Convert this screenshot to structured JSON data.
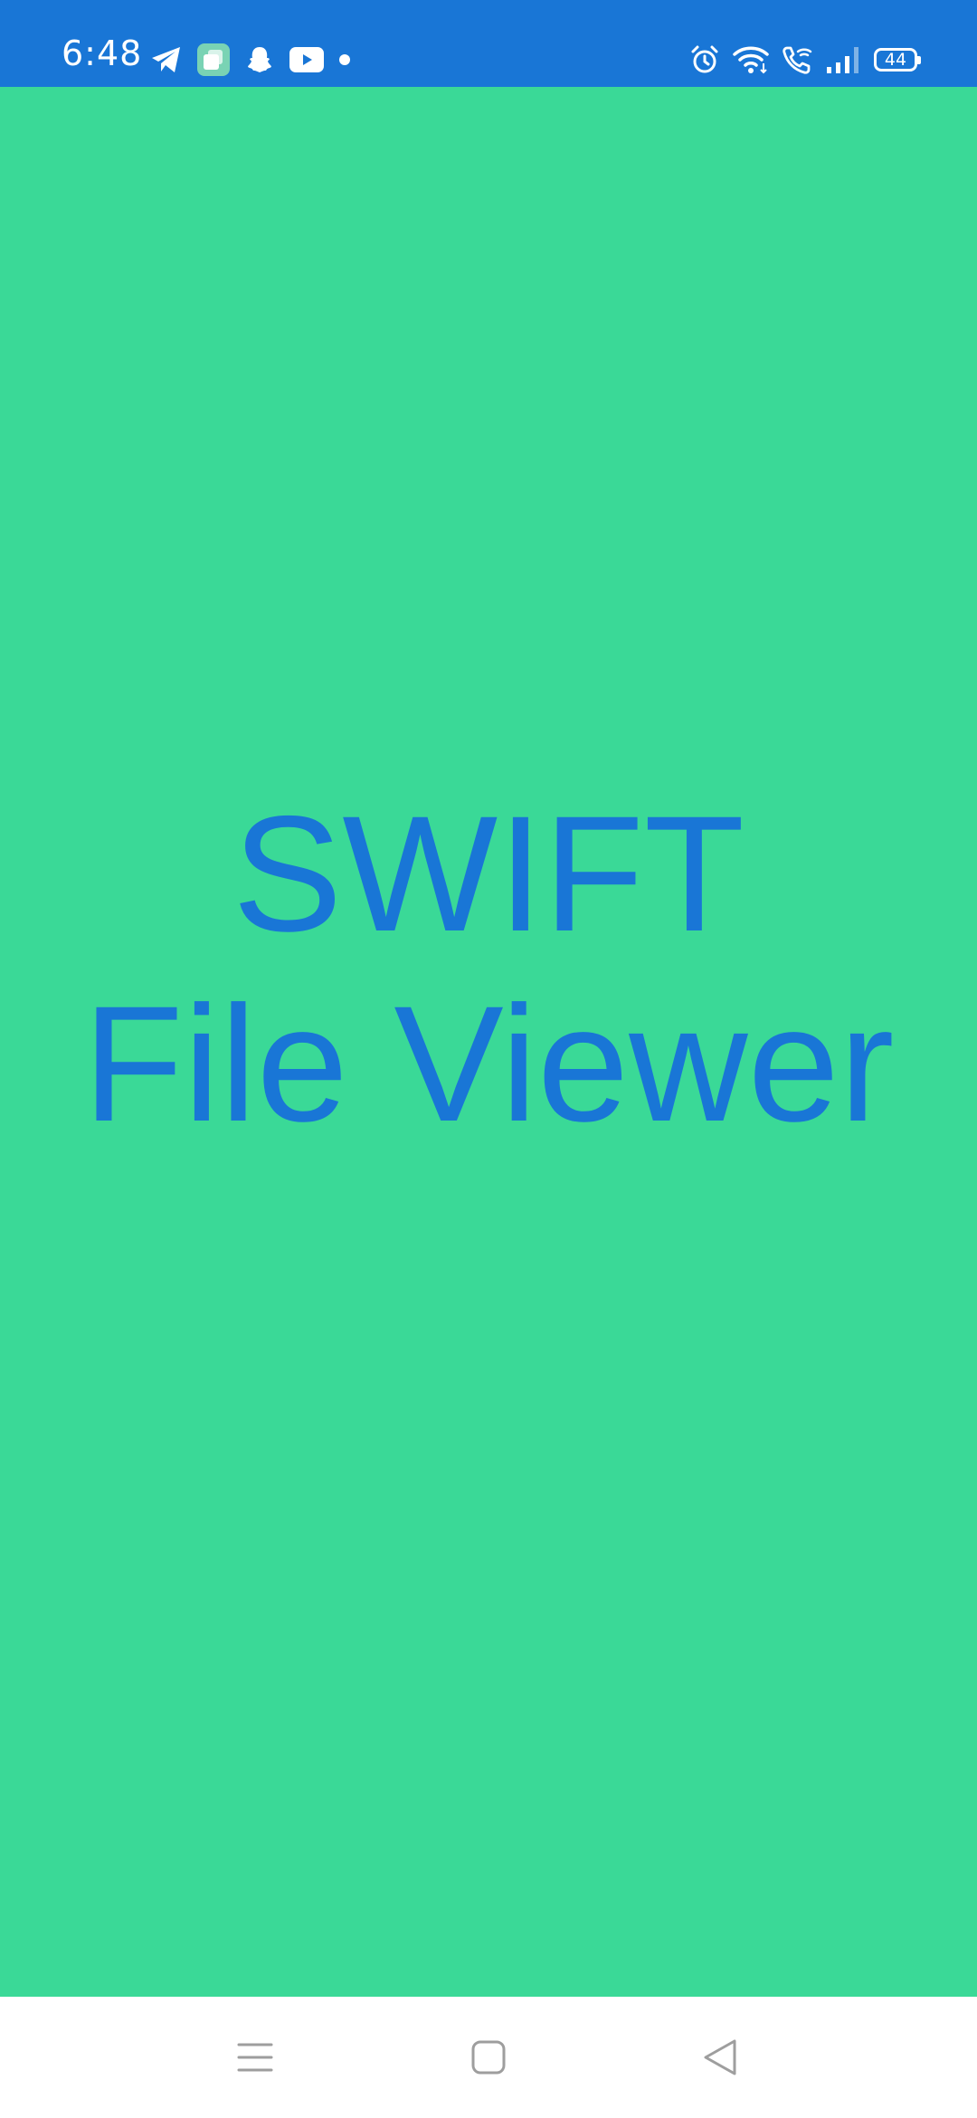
{
  "status_bar": {
    "time": "6:48",
    "battery_level": "44",
    "background_color": "#1976d6",
    "left_icons": [
      "telegram-icon",
      "app-layers-icon",
      "snapchat-icon",
      "youtube-icon",
      "notification-dot-icon"
    ],
    "right_icons": [
      "alarm-icon",
      "wifi-icon",
      "wifi-call-icon",
      "signal-icon",
      "battery-icon"
    ]
  },
  "splash": {
    "title_line1": "SWIFT",
    "title_line2": "File Viewer",
    "background_color": "#3ad997",
    "text_color": "#1976d6"
  },
  "nav_bar": {
    "buttons": [
      "menu-icon",
      "home-icon",
      "back-icon"
    ]
  }
}
